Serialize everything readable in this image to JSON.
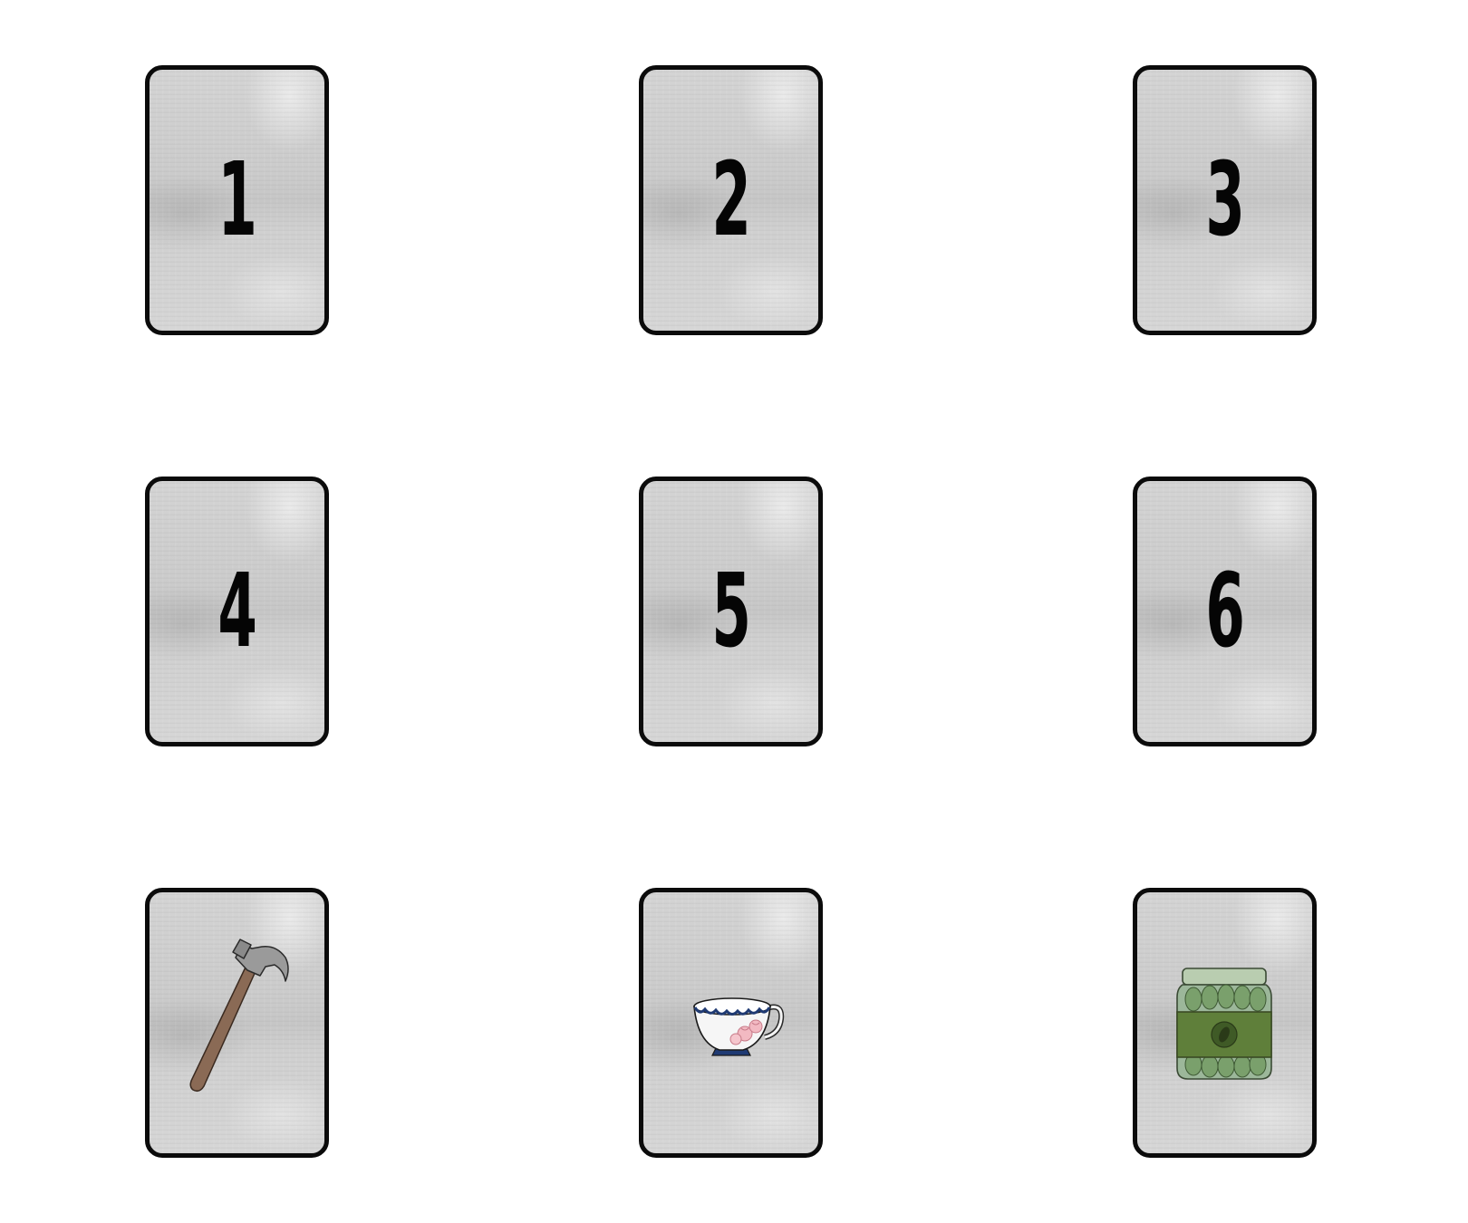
{
  "board": {
    "number_cards": [
      {
        "number": "1"
      },
      {
        "number": "2"
      },
      {
        "number": "3"
      },
      {
        "number": "4"
      },
      {
        "number": "5"
      },
      {
        "number": "6"
      }
    ],
    "picture_cards": [
      {
        "icon": "hammer-icon"
      },
      {
        "icon": "teacup-icon"
      },
      {
        "icon": "pickle-jar-icon"
      }
    ]
  },
  "colors": {
    "card_border": "#0b0b0b",
    "card_face": "#cfcfcf",
    "number": "#050505",
    "hammer_handle": "#8a6a55",
    "hammer_head": "#9a9a9a",
    "teacup_trim": "#1f3a73",
    "pickle_jar_green": "#5f7f3a"
  }
}
